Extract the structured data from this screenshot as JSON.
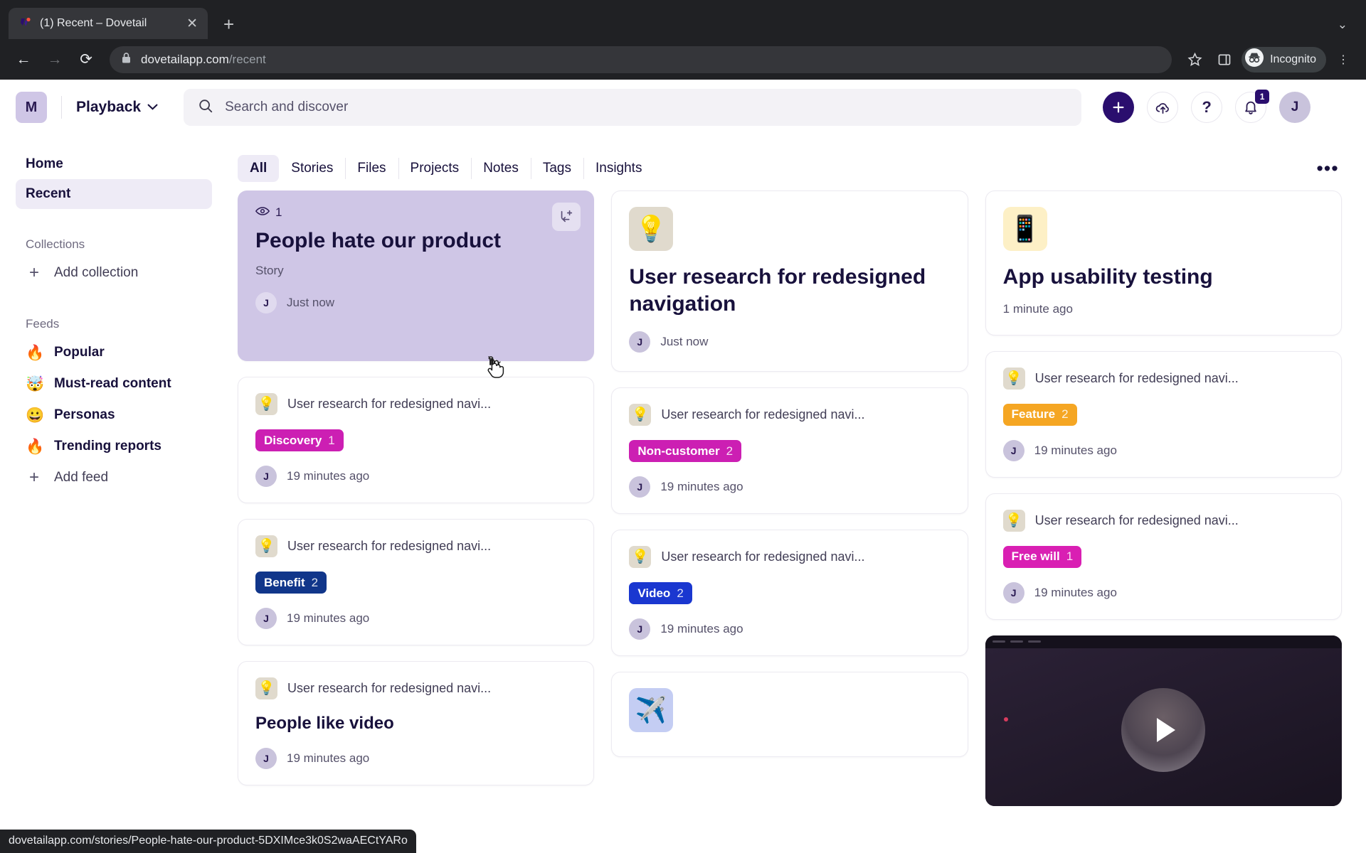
{
  "browser": {
    "tab": {
      "title": "(1) Recent – Dovetail",
      "close_icon": "close-icon",
      "favicon": "dovetail-favicon"
    },
    "new_tab_label": "+",
    "collapse_label": "⌄",
    "back_label": "←",
    "forward_label": "→",
    "reload_label": "⟳",
    "url_domain": "dovetailapp.com",
    "url_path": "/recent",
    "lock_icon": "lock-icon",
    "bookmark_icon": "star-icon",
    "sidepanel_icon": "side-panel-icon",
    "incognito_label": "Incognito",
    "menu_label": "⋮",
    "status_url": "dovetailapp.com/stories/People-hate-our-product-5DXIMce3k0S2waAECtYARo"
  },
  "appbar": {
    "workspace_initial": "M",
    "project_name": "Playback",
    "chevron": "⌄",
    "search": {
      "placeholder": "Search and discover",
      "value": ""
    },
    "create_label": "+",
    "upload_icon": "cloud-upload-icon",
    "help_label": "?",
    "notifications_count": "1",
    "user_initial": "J"
  },
  "sidebar": {
    "home_label": "Home",
    "recent_label": "Recent",
    "collections_heading": "Collections",
    "add_collection_label": "Add collection",
    "feeds_heading": "Feeds",
    "feeds": [
      {
        "emoji": "🔥",
        "label": "Popular"
      },
      {
        "emoji": "🤯",
        "label": "Must-read content"
      },
      {
        "emoji": "😀",
        "label": "Personas"
      },
      {
        "emoji": "🔥",
        "label": "Trending reports"
      }
    ],
    "add_feed_label": "Add feed"
  },
  "filter_tabs": [
    {
      "label": "All",
      "active": true
    },
    {
      "label": "Stories",
      "active": false
    },
    {
      "label": "Files",
      "active": false
    },
    {
      "label": "Projects",
      "active": false
    },
    {
      "label": "Notes",
      "active": false
    },
    {
      "label": "Tags",
      "active": false
    },
    {
      "label": "Insights",
      "active": false
    }
  ],
  "overflow_label": "•••",
  "cards": {
    "c1": {
      "views": "1",
      "title": "People hate our product",
      "kind": "Story",
      "author_initial": "J",
      "time": "Just now",
      "action_icon": "add-to-collection-icon"
    },
    "c2": {
      "emoji": "💡",
      "source": "User research for redesigned navi...",
      "tag": "Discovery",
      "tag_count": "1",
      "tag_color": "#cc1fb3",
      "author_initial": "J",
      "time": "19 minutes ago"
    },
    "c3": {
      "emoji": "💡",
      "source": "User research for redesigned navi...",
      "tag": "Benefit",
      "tag_count": "2",
      "tag_color": "#11368a",
      "author_initial": "J",
      "time": "19 minutes ago"
    },
    "c4": {
      "emoji": "💡",
      "source": "User research for redesigned navi...",
      "note_title": "People like video",
      "author_initial": "J",
      "time": "19 minutes ago"
    },
    "c5": {
      "emoji": "💡",
      "title": "User research for redesigned navigation",
      "author_initial": "J",
      "time": "Just now"
    },
    "c6": {
      "emoji": "💡",
      "source": "User research for redesigned navi...",
      "tag": "Non-customer",
      "tag_count": "2",
      "tag_color": "#cc1fb3",
      "author_initial": "J",
      "time": "19 minutes ago"
    },
    "c7": {
      "emoji": "💡",
      "source": "User research for redesigned navi...",
      "tag": "Video",
      "tag_count": "2",
      "tag_color": "#1a37d0",
      "author_initial": "J",
      "time": "19 minutes ago"
    },
    "c8": {
      "emoji": "✈️"
    },
    "c9": {
      "emoji": "📱",
      "title": "App usability testing",
      "time": "1 minute ago"
    },
    "c10": {
      "emoji": "💡",
      "source": "User research for redesigned navi...",
      "tag": "Feature",
      "tag_count": "2",
      "tag_color": "#f5a623",
      "author_initial": "J",
      "time": "19 minutes ago"
    },
    "c11": {
      "emoji": "💡",
      "source": "User research for redesigned navi...",
      "tag": "Free will",
      "tag_count": "1",
      "tag_color": "#d91fb3",
      "author_initial": "J",
      "time": "19 minutes ago"
    },
    "c12": {
      "play_icon": "play-icon"
    }
  },
  "colors": {
    "brand_purple": "#2a0e6e",
    "featured_card": "#cfc6e6",
    "accent_text": "#18113c"
  }
}
